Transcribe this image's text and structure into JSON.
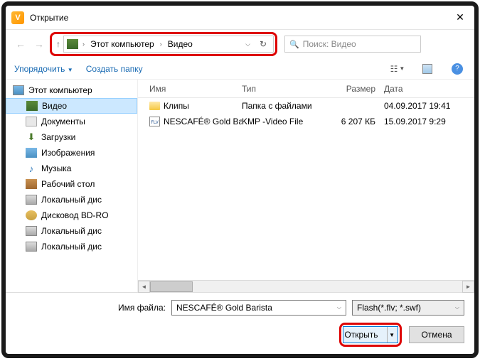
{
  "window": {
    "title": "Открытие"
  },
  "breadcrumb": {
    "root": "Этот компьютер",
    "folder": "Видео"
  },
  "search": {
    "placeholder": "Поиск: Видео"
  },
  "toolbar": {
    "organize": "Упорядочить",
    "new_folder": "Создать папку"
  },
  "tree": {
    "root": "Этот компьютер",
    "items": [
      {
        "label": "Видео"
      },
      {
        "label": "Документы"
      },
      {
        "label": "Загрузки"
      },
      {
        "label": "Изображения"
      },
      {
        "label": "Музыка"
      },
      {
        "label": "Рабочий стол"
      },
      {
        "label": "Локальный дис"
      },
      {
        "label": "Дисковод BD-RO"
      },
      {
        "label": "Локальный дис"
      },
      {
        "label": "Локальный дис"
      }
    ]
  },
  "columns": {
    "name": "Имя",
    "type": "Тип",
    "size": "Размер",
    "date": "Дата"
  },
  "files": [
    {
      "name": "Клипы",
      "type": "Папка с файлами",
      "size": "",
      "date": "04.09.2017 19:41"
    },
    {
      "name": "NESCAFÉ® Gold Ba...",
      "type": "KMP -Video File",
      "size": "6 207 КБ",
      "date": "15.09.2017 9:29"
    }
  ],
  "filename": {
    "label": "Имя файла:",
    "value": "NESCAFÉ® Gold Barista"
  },
  "filter": {
    "value": "Flash(*.flv; *.swf)"
  },
  "buttons": {
    "open": "Открыть",
    "cancel": "Отмена"
  }
}
